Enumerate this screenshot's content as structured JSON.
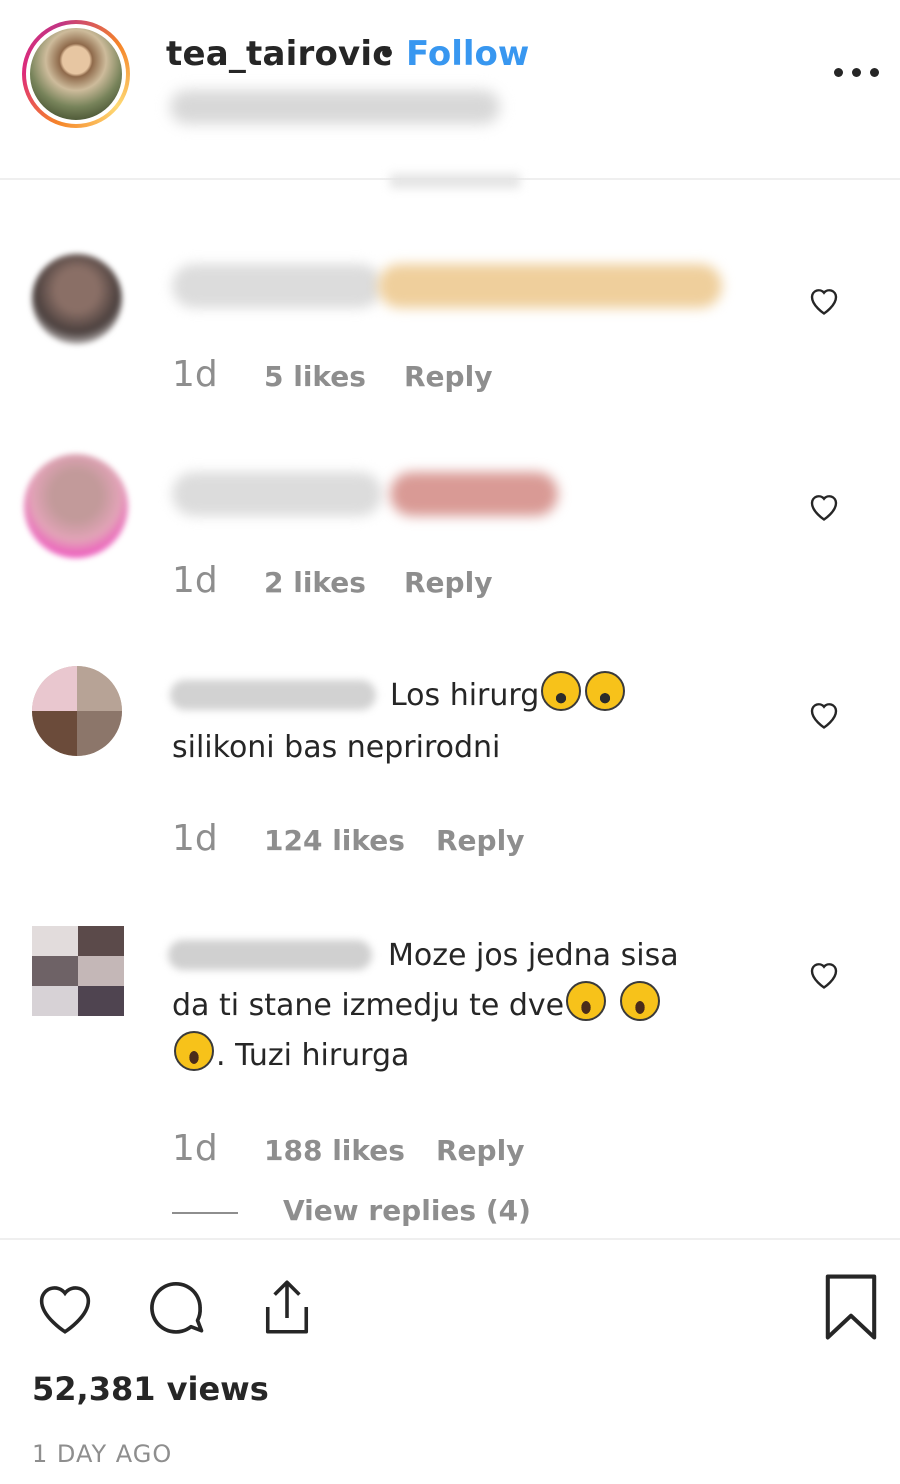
{
  "header": {
    "username": "tea_tairovic",
    "separator": "•",
    "follow_label": "Follow"
  },
  "comments": [
    {
      "time": "1d",
      "likes": "5 likes",
      "reply": "Reply"
    },
    {
      "time": "1d",
      "likes": "2 likes",
      "reply": "Reply"
    },
    {
      "line1": "Los hirurg",
      "line2": "silikoni bas neprirodni",
      "time": "1d",
      "likes": "124 likes",
      "reply": "Reply"
    },
    {
      "line1": "Moze jos jedna sisa",
      "line2": "da ti stane izmedju te dve",
      "line3": ". Tuzi hirurga",
      "time": "1d",
      "likes": "188 likes",
      "reply": "Reply",
      "view_replies": "View replies (4)"
    }
  ],
  "actions": {
    "views": "52,381 views",
    "timestamp": "1 DAY AGO"
  },
  "colors": {
    "accent": "#3897f0",
    "muted": "#8e8e8e",
    "text": "#262626"
  },
  "icons": [
    "more-options-icon",
    "heart-icon",
    "comment-icon",
    "share-icon",
    "bookmark-icon",
    "face-screaming-emoji",
    "tears-of-joy-emoji"
  ]
}
